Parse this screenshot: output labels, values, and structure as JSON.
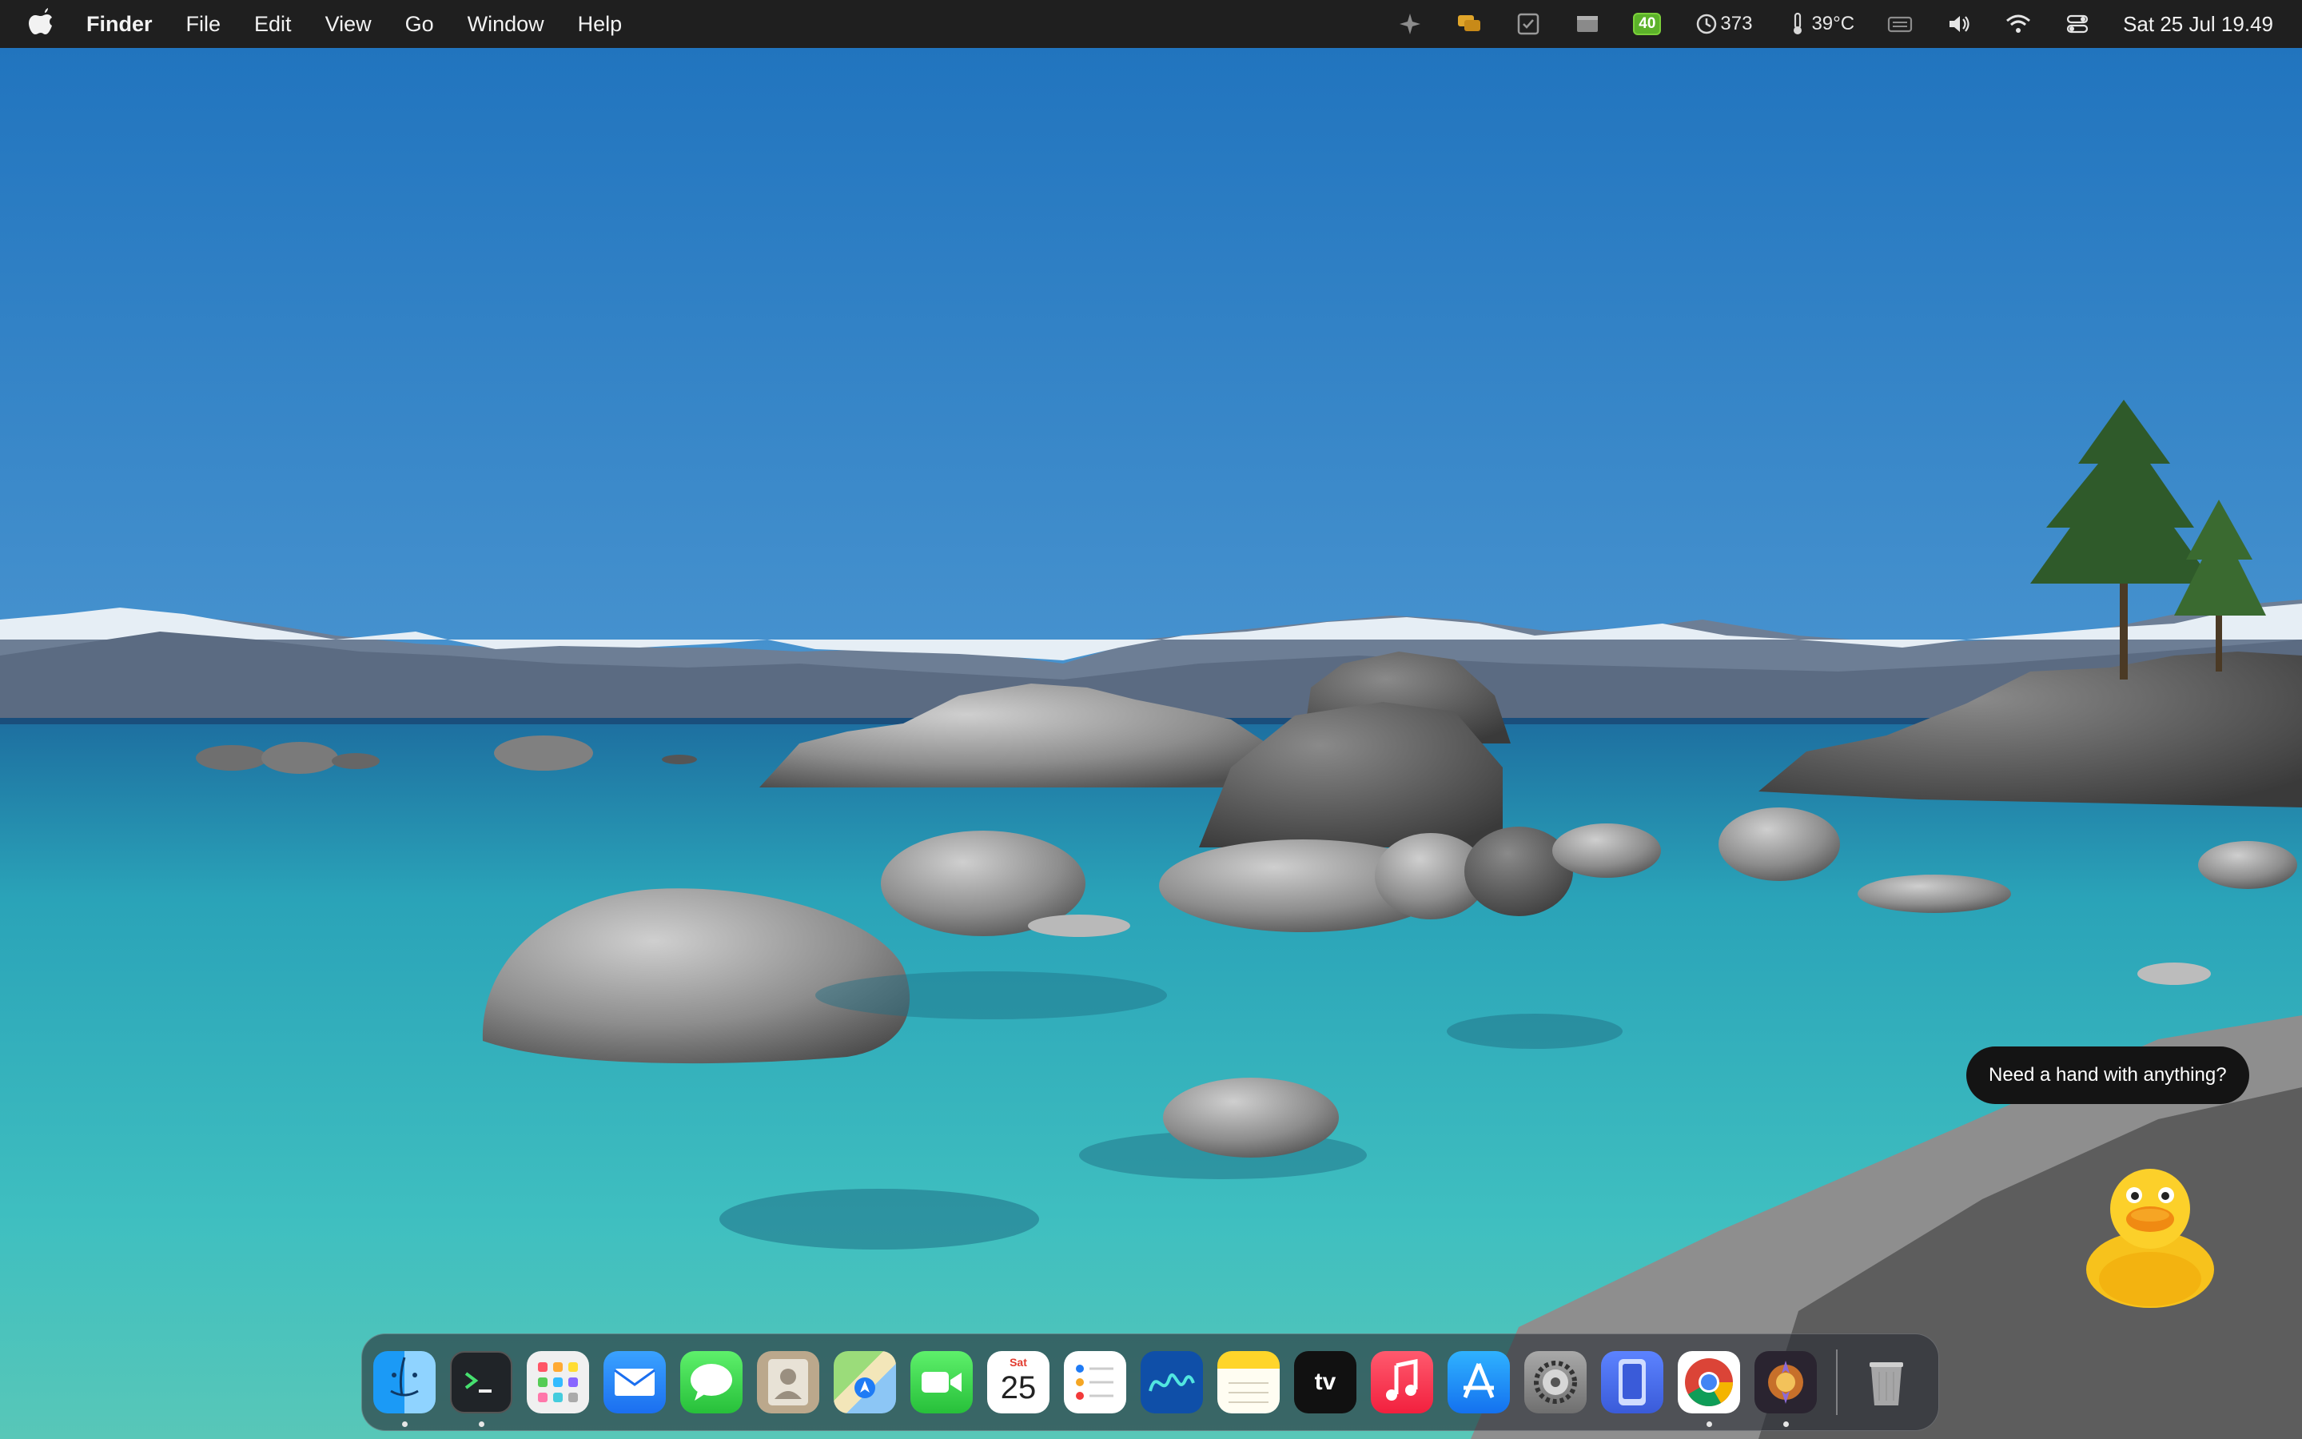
{
  "menubar": {
    "apple_glyph": "",
    "app_name": "Finder",
    "menus": [
      "File",
      "Edit",
      "View",
      "Go",
      "Window",
      "Help"
    ],
    "status": {
      "battery": "40",
      "history_count": "373",
      "temperature": "39°C",
      "datetime": "Sat 25 Jul  19.49"
    }
  },
  "assistant": {
    "bubble_text": "Need a hand with anything?",
    "icon": "duck-mascot"
  },
  "dock": {
    "apps": [
      {
        "name": "Finder",
        "icon": "finder-icon",
        "running": true
      },
      {
        "name": "Terminal",
        "icon": "terminal-icon",
        "running": true
      },
      {
        "name": "Launchpad",
        "icon": "launchpad-icon",
        "running": false
      },
      {
        "name": "Mail",
        "icon": "mail-icon",
        "running": false
      },
      {
        "name": "Messages",
        "icon": "messages-icon",
        "running": false
      },
      {
        "name": "Contacts",
        "icon": "contacts-icon",
        "running": false
      },
      {
        "name": "Maps",
        "icon": "maps-icon",
        "running": false
      },
      {
        "name": "FaceTime",
        "icon": "facetime-icon",
        "running": false
      },
      {
        "name": "Calendar",
        "icon": "calendar-icon",
        "running": false
      },
      {
        "name": "Reminders",
        "icon": "reminders-icon",
        "running": false
      },
      {
        "name": "Freeform",
        "icon": "freeform-icon",
        "running": false
      },
      {
        "name": "Notes",
        "icon": "notes-icon",
        "running": false
      },
      {
        "name": "TV",
        "icon": "tv-icon",
        "running": false
      },
      {
        "name": "Music",
        "icon": "music-icon",
        "running": false
      },
      {
        "name": "App Store",
        "icon": "app-store-icon",
        "running": false
      },
      {
        "name": "System Settings",
        "icon": "system-settings-icon",
        "running": false
      },
      {
        "name": "iPhone Mirroring",
        "icon": "iphone-mirroring-icon",
        "running": false
      },
      {
        "name": "Chrome",
        "icon": "chrome-icon",
        "running": true
      },
      {
        "name": "Game App",
        "icon": "game-icon",
        "running": true
      }
    ],
    "calendar": {
      "day": "Sat",
      "date": "25"
    },
    "tv_label": "tv",
    "trash": {
      "name": "Trash",
      "icon": "trash-icon"
    }
  }
}
